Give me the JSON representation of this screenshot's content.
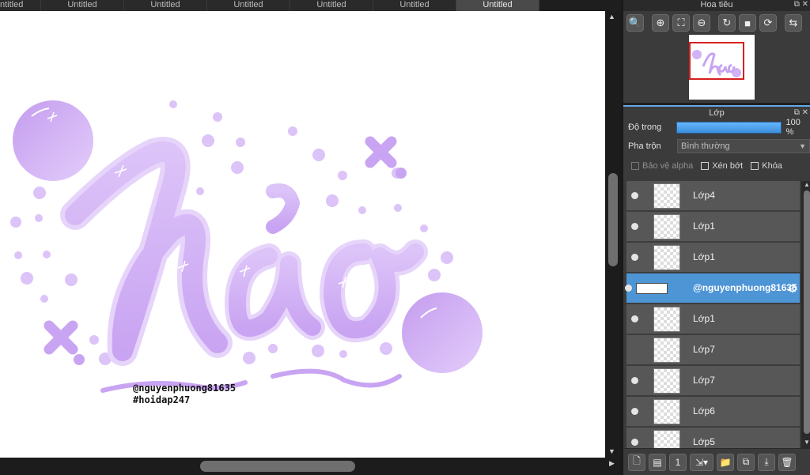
{
  "tabs": [
    {
      "label": "ntitled"
    },
    {
      "label": "Untitled"
    },
    {
      "label": "Untitled"
    },
    {
      "label": "Untitled"
    },
    {
      "label": "Untitled"
    },
    {
      "label": "Untitled"
    },
    {
      "label": "Untitled"
    }
  ],
  "canvas": {
    "artwork_text": "hào",
    "watermark_line1": "@nguyenphuong81635",
    "watermark_line2": "#hoidap247",
    "accent_color": "#c9a4f2"
  },
  "navigator": {
    "title": "Hoa tiêu",
    "tools": [
      "zoom-in-icon",
      "zoom-out-icon",
      "fit-icon",
      "rotate-icon",
      "flip-icon"
    ]
  },
  "layers_panel": {
    "title": "Lớp",
    "opacity_label": "Độ trong",
    "opacity_value": "100 %",
    "opacity_percent": 100,
    "blend_label": "Pha trộn",
    "blend_value": "Bình thường",
    "protect_alpha": "Bảo vệ alpha",
    "clipping": "Xén bớt",
    "lock": "Khóa",
    "layers": [
      {
        "name": "Lớp4",
        "visible": true,
        "selected": false
      },
      {
        "name": "Lớp1",
        "visible": true,
        "selected": false
      },
      {
        "name": "Lớp1",
        "visible": true,
        "selected": false
      },
      {
        "name": "@nguyenphuong81635",
        "visible": true,
        "selected": true
      },
      {
        "name": "Lớp1",
        "visible": true,
        "selected": false
      },
      {
        "name": "Lớp7",
        "visible": false,
        "selected": false
      },
      {
        "name": "Lớp7",
        "visible": true,
        "selected": false
      },
      {
        "name": "Lớp6",
        "visible": true,
        "selected": false
      },
      {
        "name": "Lớp5",
        "visible": true,
        "selected": false
      }
    ],
    "selected_color": "#4e95d6"
  }
}
